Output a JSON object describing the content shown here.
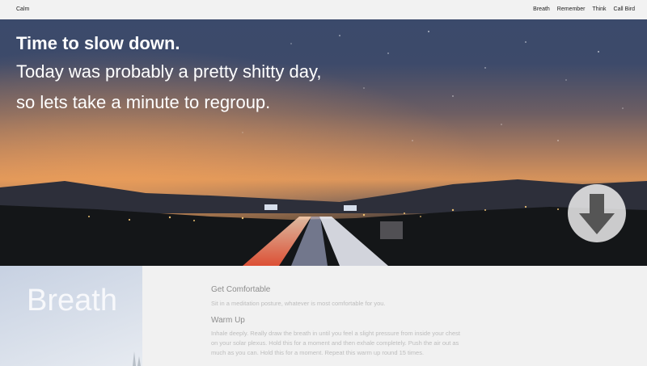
{
  "header": {
    "brand": "Calm",
    "nav": [
      "Breath",
      "Remember",
      "Think",
      "Call Bird"
    ]
  },
  "hero": {
    "title": "Time to slow down.",
    "line1": "Today was probably a pretty shitty day,",
    "line2": "so lets take a minute to regroup.",
    "scroll_icon": "arrow-down-icon"
  },
  "section": {
    "side_label": "Breath",
    "blocks": [
      {
        "heading": "Get Comfortable",
        "text": "Sit in a meditation posture, whatever is most comfortable for you."
      },
      {
        "heading": "Warm Up",
        "text_lines": [
          "Inhale deeply. Really draw the breath in until you feel a slight pressure from inside your chest",
          "on your solar plexus. Hold this for a moment and then exhale completely. Push the air out as",
          "much as you can. Hold this for a moment. Repeat this warm up round 15 times."
        ]
      }
    ]
  },
  "colors": {
    "topbar": "#f2f2f2",
    "page": "#f1f1f1",
    "heading_gray": "#8d8d8d",
    "body_gray": "#bdbdbd"
  }
}
